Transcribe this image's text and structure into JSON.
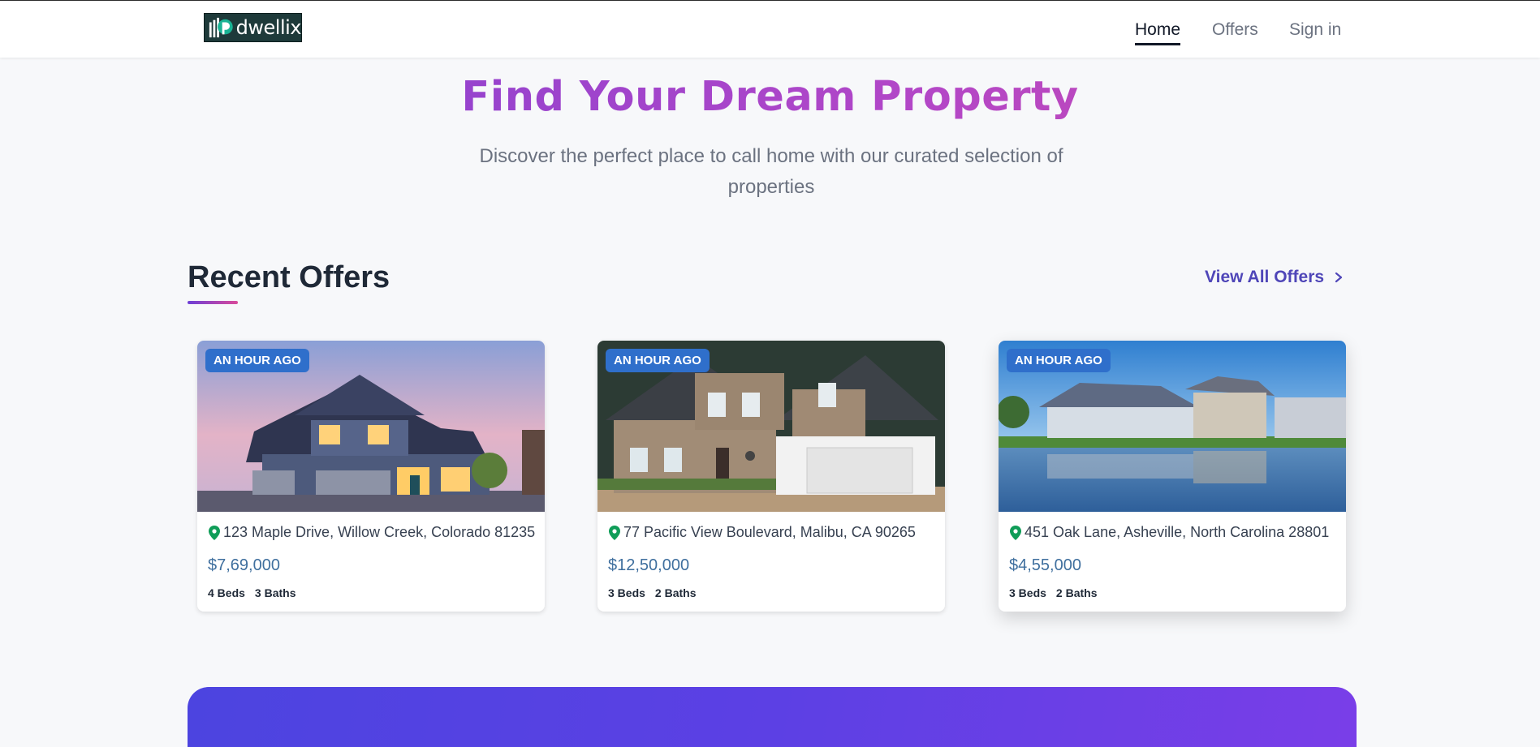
{
  "brand": {
    "name": "dwellix"
  },
  "nav": {
    "home": "Home",
    "offers": "Offers",
    "signin": "Sign in"
  },
  "hero": {
    "title": "Find Your Dream Property",
    "subtitle": "Discover the perfect place to call home with our curated selection of properties"
  },
  "recent": {
    "title": "Recent Offers",
    "view_all": "View All Offers"
  },
  "listings": [
    {
      "badge": "AN HOUR AGO",
      "address": "123 Maple Drive, Willow Creek, Colorado 81235",
      "price": "$7,69,000",
      "beds": "4 Beds",
      "baths": "3 Baths"
    },
    {
      "badge": "AN HOUR AGO",
      "address": "77 Pacific View Boulevard, Malibu, CA 90265",
      "price": "$12,50,000",
      "beds": "3 Beds",
      "baths": "2 Baths"
    },
    {
      "badge": "AN HOUR AGO",
      "address": "451 Oak Lane, Asheville, North Carolina 28801",
      "price": "$4,55,000",
      "beds": "3 Beds",
      "baths": "2 Baths"
    }
  ],
  "colors": {
    "accent": "#4f46b8",
    "badge": "#2f6fcb",
    "price": "#3f6f9e",
    "pin": "#0f9d58"
  },
  "icons": [
    "dwellix-logo-icon",
    "map-pin-icon",
    "chevron-right-icon"
  ]
}
